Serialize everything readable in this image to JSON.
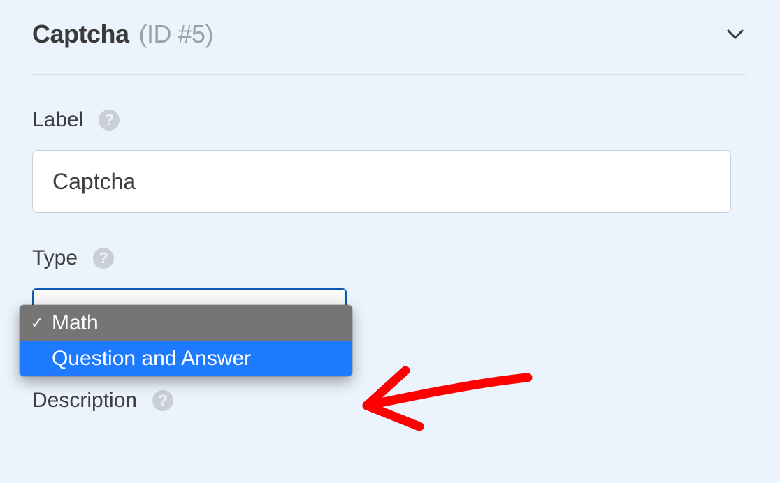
{
  "header": {
    "name": "Captcha",
    "id_text": "(ID #5)"
  },
  "fields": {
    "label": {
      "label": "Label",
      "value": "Captcha"
    },
    "type": {
      "label": "Type",
      "options": [
        {
          "label": "Math",
          "selected": true,
          "highlighted": false
        },
        {
          "label": "Question and Answer",
          "selected": false,
          "highlighted": true
        }
      ]
    },
    "description": {
      "label": "Description"
    }
  }
}
